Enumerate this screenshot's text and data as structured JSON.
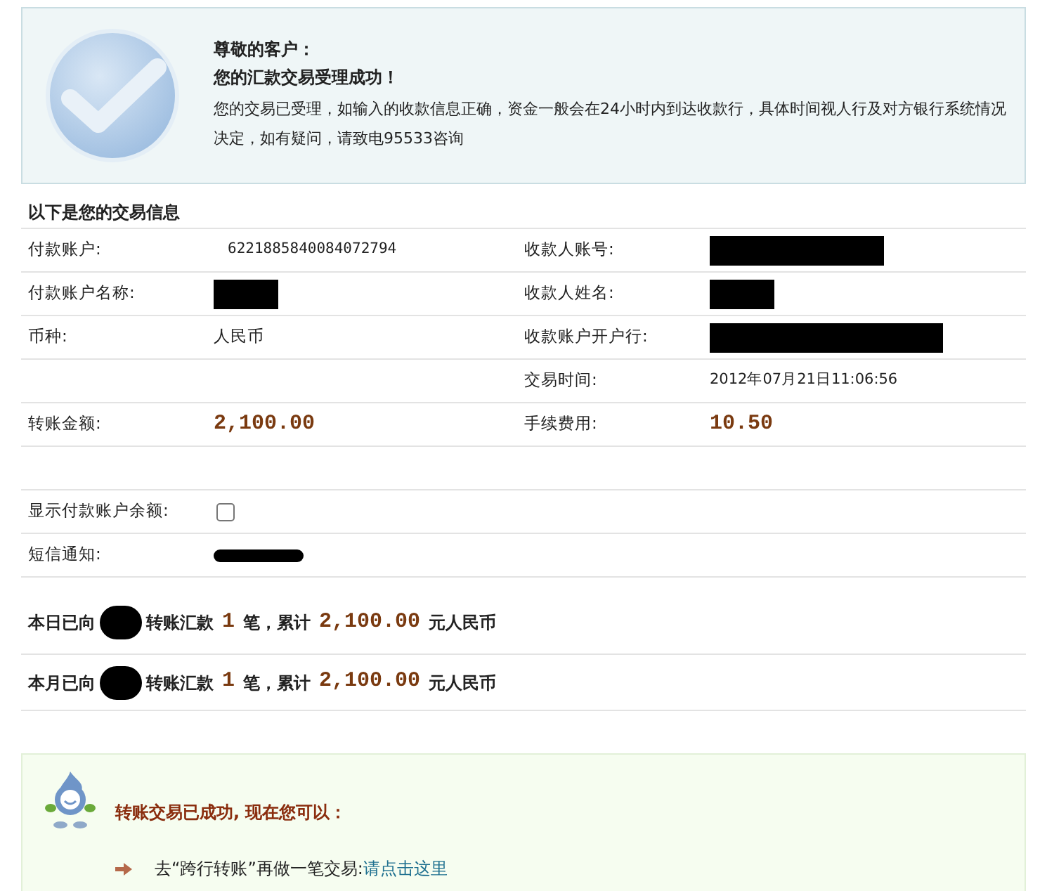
{
  "notice": {
    "greeting": "尊敬的客户：",
    "title": "您的汇款交易受理成功！",
    "message": "您的交易已受理，如输入的收款信息正确，资金一般会在24小时内到达收款行，具体时间视人行及对方银行系统情况决定，如有疑问，请致电95533咨询"
  },
  "details": {
    "heading": "以下是您的交易信息",
    "rows": [
      [
        {
          "kind": "label",
          "text": "付款账户:"
        },
        {
          "kind": "mono",
          "text": "6221885840084072794"
        },
        {
          "kind": "label",
          "text": "收款人账号:"
        },
        {
          "kind": "redacted"
        }
      ],
      [
        {
          "kind": "label",
          "text": "付款账户名称:"
        },
        {
          "kind": "redacted"
        },
        {
          "kind": "label",
          "text": "收款人姓名:"
        },
        {
          "kind": "redacted"
        }
      ],
      [
        {
          "kind": "label",
          "text": "币种:"
        },
        {
          "kind": "text",
          "text": "人民币"
        },
        {
          "kind": "label",
          "text": "收款账户开户行:"
        },
        {
          "kind": "redacted"
        }
      ],
      [
        {
          "kind": "empty"
        },
        {
          "kind": "empty"
        },
        {
          "kind": "label",
          "text": "交易时间:"
        },
        {
          "kind": "mono",
          "text": "2012年07月21日11:06:56"
        }
      ],
      [
        {
          "kind": "label",
          "text": "转账金额:"
        },
        {
          "kind": "amount",
          "text": "2,100.00"
        },
        {
          "kind": "label",
          "text": "手续费用:"
        },
        {
          "kind": "amount",
          "text": "10.50"
        }
      ]
    ]
  },
  "options": [
    {
      "kind": "checkbox",
      "label": "显示付款账户余额:",
      "checked": false
    },
    {
      "kind": "redacted",
      "label": "短信通知:"
    }
  ],
  "summaries": [
    [
      {
        "kind": "text",
        "text": "本日已向"
      },
      {
        "kind": "redacted"
      },
      {
        "kind": "text",
        "text": "转账汇款"
      },
      {
        "kind": "number",
        "text": "1"
      },
      {
        "kind": "text",
        "text": "笔，累计"
      },
      {
        "kind": "number",
        "text": "2,100.00"
      },
      {
        "kind": "text",
        "text": "元人民币"
      }
    ],
    [
      {
        "kind": "text",
        "text": "本月已向"
      },
      {
        "kind": "redacted"
      },
      {
        "kind": "text",
        "text": "转账汇款"
      },
      {
        "kind": "number",
        "text": "1"
      },
      {
        "kind": "text",
        "text": "笔，累计"
      },
      {
        "kind": "number",
        "text": "2,100.00"
      },
      {
        "kind": "text",
        "text": "元人民币"
      }
    ]
  ],
  "next_steps": {
    "title": "转账交易已成功, 现在您可以：",
    "items": [
      {
        "text": "去“跨行转账”再做一笔交易:",
        "link": "请点击这里"
      }
    ]
  }
}
